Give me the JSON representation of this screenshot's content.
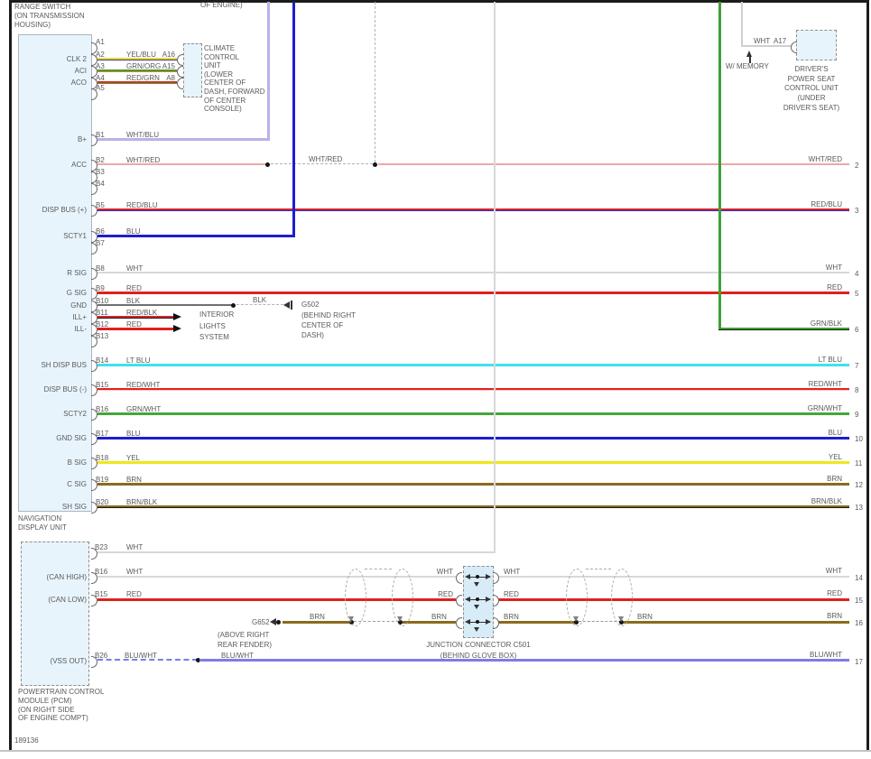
{
  "diagram": {
    "number": "189136",
    "top_left_label": "RANGE SWITCH\n(ON TRANSMISSION\nHOUSING)",
    "top_center_fragment": "OF ENGINE)"
  },
  "climate_unit": {
    "label": "CLIMATE\nCONTROL\nUNIT\n(LOWER\nCENTER OF\nDASH, FORWARD\nOF CENTER\nCONSOLE)",
    "pins": [
      "A16",
      "A15",
      "A8"
    ]
  },
  "seat_unit": {
    "label": "DRIVER'S\nPOWER SEAT\nCONTROL UNIT\n(UNDER\nDRIVER'S SEAT)",
    "wire_color": "WHT",
    "pin": "A17",
    "memory_note": "W/ MEMORY"
  },
  "nav_unit": {
    "label": "NAVIGATION\nDISPLAY UNIT",
    "pins": [
      {
        "pin": "A1"
      },
      {
        "pin": "A2",
        "name": "CLK 2",
        "color": "YEL/BLU",
        "dest": "A16"
      },
      {
        "pin": "A3",
        "name": "ACI",
        "color": "GRN/ORG",
        "dest": "A15"
      },
      {
        "pin": "A4",
        "name": "ACO",
        "color": "RED/GRN",
        "dest": "A8"
      },
      {
        "pin": "A5"
      },
      {
        "pin": "B1",
        "name": "B+",
        "color": "WHT/BLU"
      },
      {
        "pin": "B2",
        "name": "ACC",
        "color": "WHT/RED",
        "mid": "WHT/RED",
        "right": "WHT/RED",
        "num": "2"
      },
      {
        "pin": "B3"
      },
      {
        "pin": "B4"
      },
      {
        "pin": "B5",
        "name": "DISP BUS (+)",
        "color": "RED/BLU",
        "right": "RED/BLU",
        "num": "3"
      },
      {
        "pin": "B6",
        "name": "SCTY1",
        "color": "BLU"
      },
      {
        "pin": "B7"
      },
      {
        "pin": "B8",
        "name": "R SIG",
        "color": "WHT",
        "right": "WHT",
        "num": "4"
      },
      {
        "pin": "B9",
        "name": "G SIG",
        "color": "RED",
        "right": "RED",
        "num": "5"
      },
      {
        "pin": "B10",
        "name": "GND",
        "color": "BLK",
        "mid": "BLK"
      },
      {
        "pin": "B11",
        "name": "ILL+",
        "color": "RED/BLK"
      },
      {
        "pin": "B12",
        "name": "ILL-",
        "color": "RED"
      },
      {
        "pin": "B13"
      },
      {
        "pin": "B14",
        "name": "SH DISP BUS",
        "color": "LT BLU",
        "right": "LT BLU",
        "num": "7"
      },
      {
        "pin": "B15",
        "name": "DISP BUS (-)",
        "color": "RED/WHT",
        "right": "RED/WHT",
        "num": "8"
      },
      {
        "pin": "B16",
        "name": "SCTY2",
        "color": "GRN/WHT",
        "right": "GRN/WHT",
        "num": "9"
      },
      {
        "pin": "B17",
        "name": "GND SIG",
        "color": "BLU",
        "right": "BLU",
        "num": "10"
      },
      {
        "pin": "B18",
        "name": "B SIG",
        "color": "YEL",
        "right": "YEL",
        "num": "11"
      },
      {
        "pin": "B19",
        "name": "C SIG",
        "color": "BRN",
        "right": "BRN",
        "num": "12"
      },
      {
        "pin": "B20",
        "name": "SH SIG",
        "color": "BRN/BLK",
        "right": "BRN/BLK",
        "num": "13"
      }
    ]
  },
  "grn_blk_branch": {
    "right": "GRN/BLK",
    "num": "6"
  },
  "interior_lights": {
    "label": "INTERIOR\nLIGHTS\nSYSTEM"
  },
  "grounds": {
    "g502": {
      "name": "G502",
      "location": "(BEHIND RIGHT\nCENTER OF\nDASH)"
    },
    "g652": {
      "name": "G652",
      "location": "(ABOVE RIGHT\nREAR FENDER)"
    }
  },
  "pcm": {
    "label": "POWERTRAIN CONTROL\nMODULE (PCM)\n(ON RIGHT SIDE\nOF ENGINE COMPT)",
    "pins": [
      {
        "pin": "B23",
        "color": "WHT"
      },
      {
        "pin": "B16",
        "name": "(CAN HIGH)",
        "color": "WHT",
        "jl": "WHT",
        "jr": "WHT",
        "right": "WHT",
        "num": "14"
      },
      {
        "pin": "B15",
        "name": "(CAN LOW)",
        "color": "RED",
        "jl": "RED",
        "jr": "RED",
        "right": "RED",
        "num": "15"
      },
      {
        "pin": "B26",
        "name": "(VSS OUT)",
        "color": "BLU/WHT",
        "mid": "BLU/WHT",
        "right": "BLU/WHT",
        "num": "17"
      }
    ]
  },
  "shield_row": {
    "label_a": "BRN",
    "label_b": "BRN",
    "label_c": "BRN",
    "label_d": "BRN",
    "right": "BRN",
    "num": "16"
  },
  "junction": {
    "label": "JUNCTION CONNECTOR C501",
    "location": "(BEHIND GLOVE BOX)"
  }
}
